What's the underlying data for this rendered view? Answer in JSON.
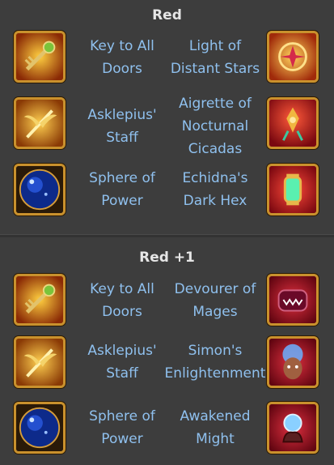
{
  "sections": [
    {
      "header": "Red",
      "rows": [
        {
          "left_name": "Key to All\nDoors",
          "left_icon": "key-to-all-doors-icon",
          "right_name": "Light of\nDistant Stars",
          "right_icon": "light-of-distant-stars-icon"
        },
        {
          "left_name": "Asklepius'\nStaff",
          "left_icon": "asklepius-staff-icon",
          "right_name": "Aigrette of\nNocturnal\nCicadas",
          "right_icon": "aigrette-of-nocturnal-cicadas-icon"
        },
        {
          "left_name": "Sphere of\nPower",
          "left_icon": "sphere-of-power-icon",
          "right_name": "Echidna's\nDark Hex",
          "right_icon": "echidnas-dark-hex-icon"
        }
      ]
    },
    {
      "header": "Red +1",
      "rows": [
        {
          "left_name": "Key to All\nDoors",
          "left_icon": "key-to-all-doors-icon",
          "right_name": "Devourer of\nMages",
          "right_icon": "devourer-of-mages-icon"
        },
        {
          "left_name": "Asklepius'\nStaff",
          "left_icon": "asklepius-staff-icon",
          "right_name": "Simon's\nEnlightenment",
          "right_icon": "simons-enlightenment-icon"
        },
        {
          "left_name": "Sphere of\nPower",
          "left_icon": "sphere-of-power-icon",
          "right_name": "Awakened\nMight",
          "right_icon": "awakened-might-icon"
        }
      ]
    }
  ],
  "colors": {
    "background": "#3d3d3d",
    "header_text": "#e6e6e6",
    "item_text": "#8fc0ee",
    "icon_border": "#c9912d"
  }
}
